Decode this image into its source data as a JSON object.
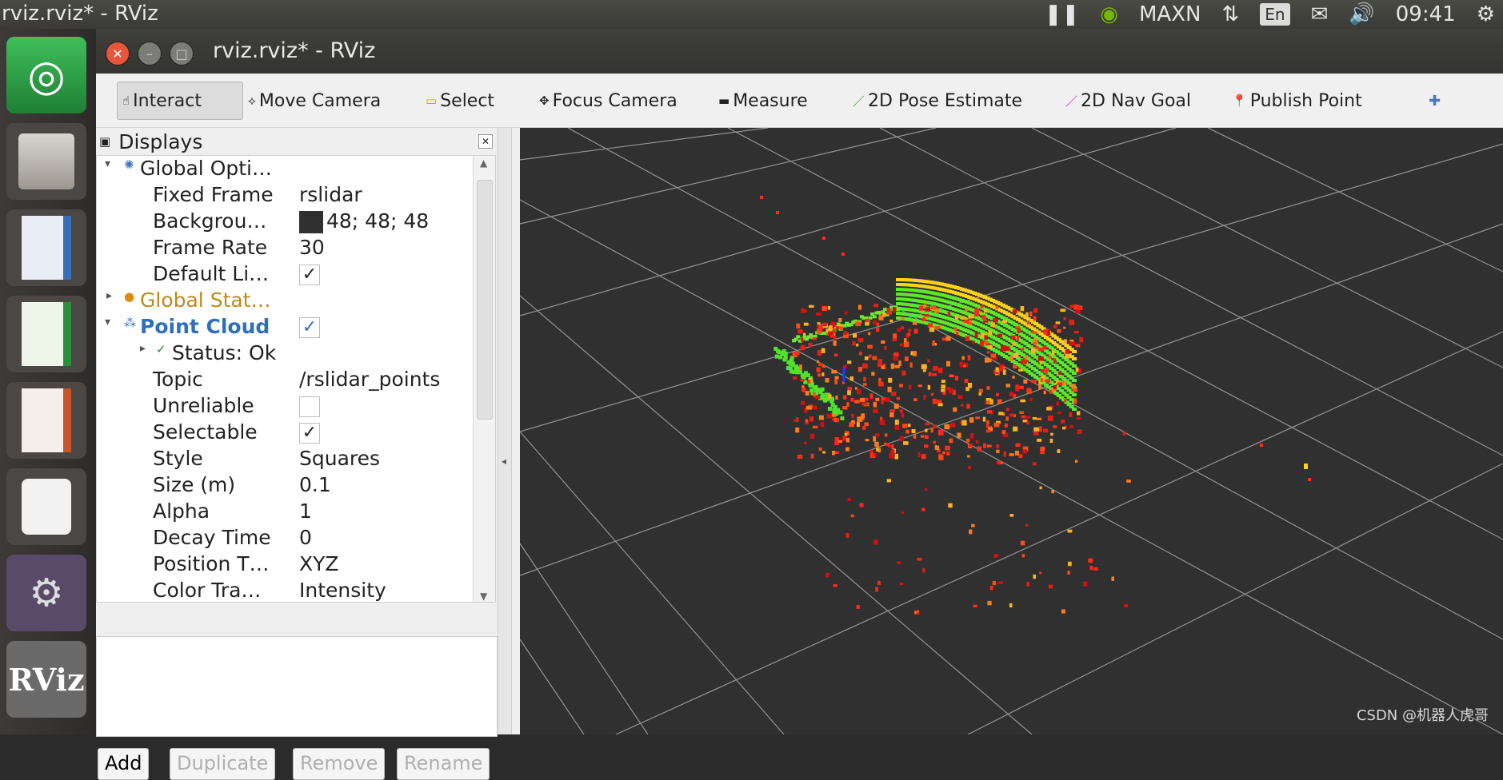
{
  "topbar": {
    "title": "rviz.rviz* - RViz",
    "gpu": "MAXN",
    "lang": "En",
    "time": "09:41"
  },
  "window": {
    "title": "rviz.rviz* - RViz"
  },
  "toolbar": {
    "interact": "Interact",
    "move_camera": "Move Camera",
    "select": "Select",
    "focus_camera": "Focus Camera",
    "measure": "Measure",
    "pose_estimate": "2D Pose Estimate",
    "nav_goal": "2D Nav Goal",
    "publish_point": "Publish Point"
  },
  "displays": {
    "header": "Displays",
    "global_options": "Global Opti…",
    "fixed_frame": {
      "name": "Fixed Frame",
      "value": "rslidar"
    },
    "background": {
      "name": "Backgrou…",
      "value": "48; 48; 48"
    },
    "frame_rate": {
      "name": "Frame Rate",
      "value": "30"
    },
    "default_light": {
      "name": "Default Li…",
      "check": "✓"
    },
    "global_status": "Global Stat…",
    "point_cloud": {
      "name": "Point Cloud",
      "check": "✓"
    },
    "status": "Status: Ok",
    "topic": {
      "name": "Topic",
      "value": "/rslidar_points"
    },
    "unreliable": {
      "name": "Unreliable"
    },
    "selectable": {
      "name": "Selectable",
      "check": "✓"
    },
    "style": {
      "name": "Style",
      "value": "Squares"
    },
    "size": {
      "name": "Size (m)",
      "value": "0.1"
    },
    "alpha": {
      "name": "Alpha",
      "value": "1"
    },
    "decay": {
      "name": "Decay Time",
      "value": "0"
    },
    "position": {
      "name": "Position T…",
      "value": "XYZ"
    },
    "color": {
      "name": "Color Tra…",
      "value": "Intensity"
    }
  },
  "buttons": {
    "add": "Add",
    "duplicate": "Duplicate",
    "remove": "Remove",
    "rename": "Rename"
  },
  "watermark": "CSDN @机器人虎哥"
}
